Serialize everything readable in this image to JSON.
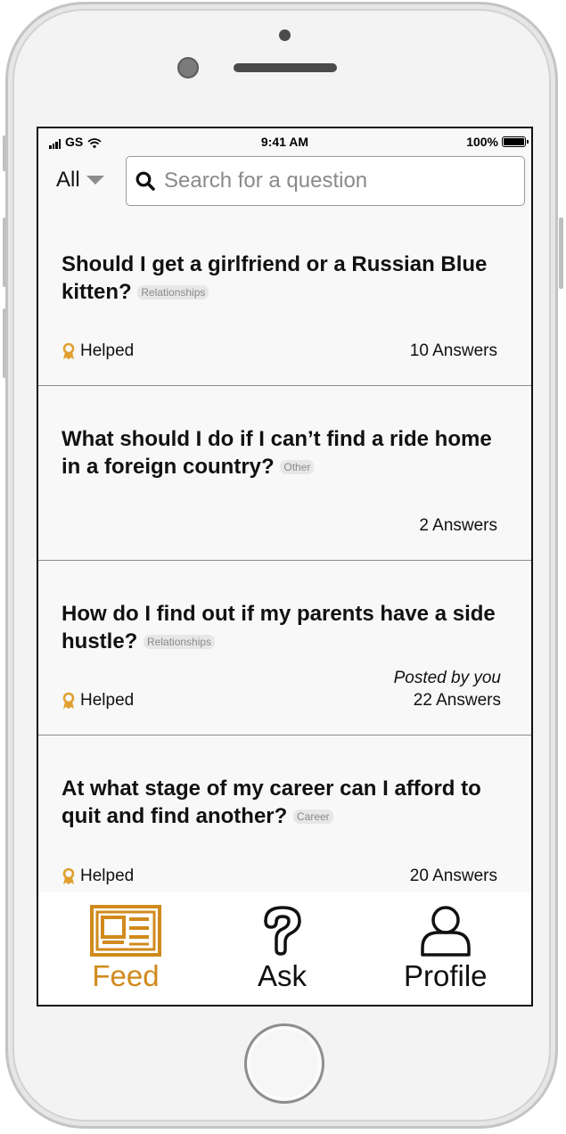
{
  "status_bar": {
    "carrier": "GS",
    "time": "9:41 AM",
    "battery": "100%"
  },
  "filter": {
    "selected": "All"
  },
  "search": {
    "placeholder": "Search for a question"
  },
  "questions": [
    {
      "title": "Should I get a girlfriend or a Russian Blue kitten?",
      "tag": "Relationships",
      "helped_label": "Helped",
      "answers": "10 Answers"
    },
    {
      "title": "What should I do if I can’t find a ride home in a foreign country?",
      "tag": "Other",
      "answers": "2 Answers"
    },
    {
      "title": "How do I find out if my parents have a side hustle?",
      "tag": "Relationships",
      "helped_label": "Helped",
      "posted_by": "Posted by you",
      "answers": "22 Answers"
    },
    {
      "title": "At what stage of my career can I afford to quit and find another?",
      "tag": "Career",
      "helped_label": "Helped",
      "answers": "20 Answers"
    }
  ],
  "tabs": [
    {
      "label": "Feed",
      "icon": "newspaper-icon",
      "active": true
    },
    {
      "label": "Ask",
      "icon": "question-icon",
      "active": false
    },
    {
      "label": "Profile",
      "icon": "user-icon",
      "active": false
    }
  ],
  "colors": {
    "accent": "#d08a1c",
    "helped_icon": "#e0a030",
    "divider": "#8a8a8a",
    "screen_bg": "#f8f8f8"
  }
}
